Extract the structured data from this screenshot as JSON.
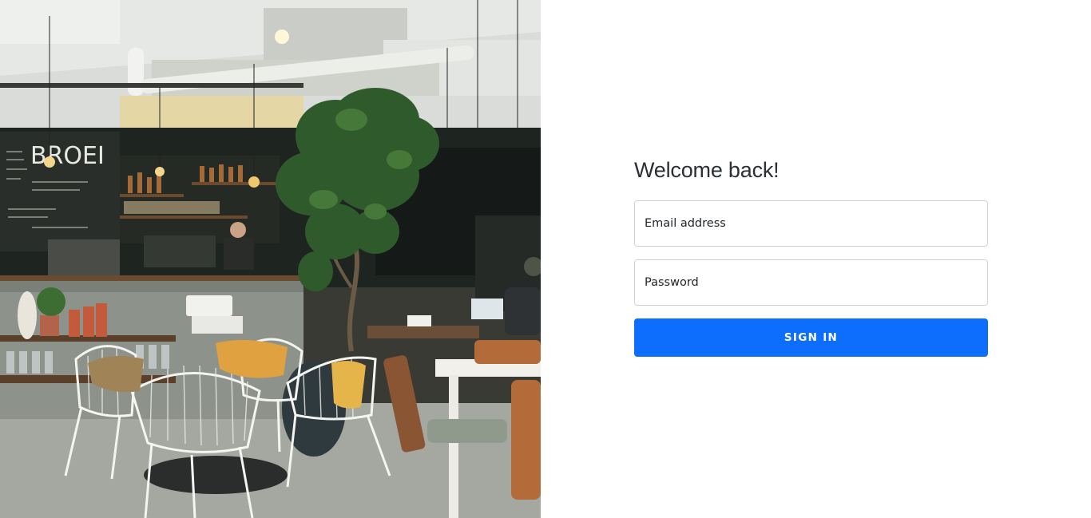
{
  "hero_image": {
    "alt": "Cafe interior with wire chairs, a fiddle-leaf fig tree and a chalkboard menu",
    "chalkboard_heading": "BROEI",
    "colors": {
      "ceiling": "#d9dcd8",
      "wall_dark": "#1e2420",
      "counter": "#8d938b",
      "floor": "#a5a7a1",
      "foliage": "#2f5a2c",
      "cushion": "#e0a240"
    }
  },
  "login": {
    "title": "Welcome back!",
    "email": {
      "placeholder": "Email address",
      "value": ""
    },
    "password": {
      "placeholder": "Password",
      "value": ""
    },
    "submit_label": "SIGN IN"
  },
  "colors": {
    "primary": "#0d6efd",
    "input_border": "#ced4da",
    "title_text": "#2b3036",
    "background": "#ffffff"
  }
}
